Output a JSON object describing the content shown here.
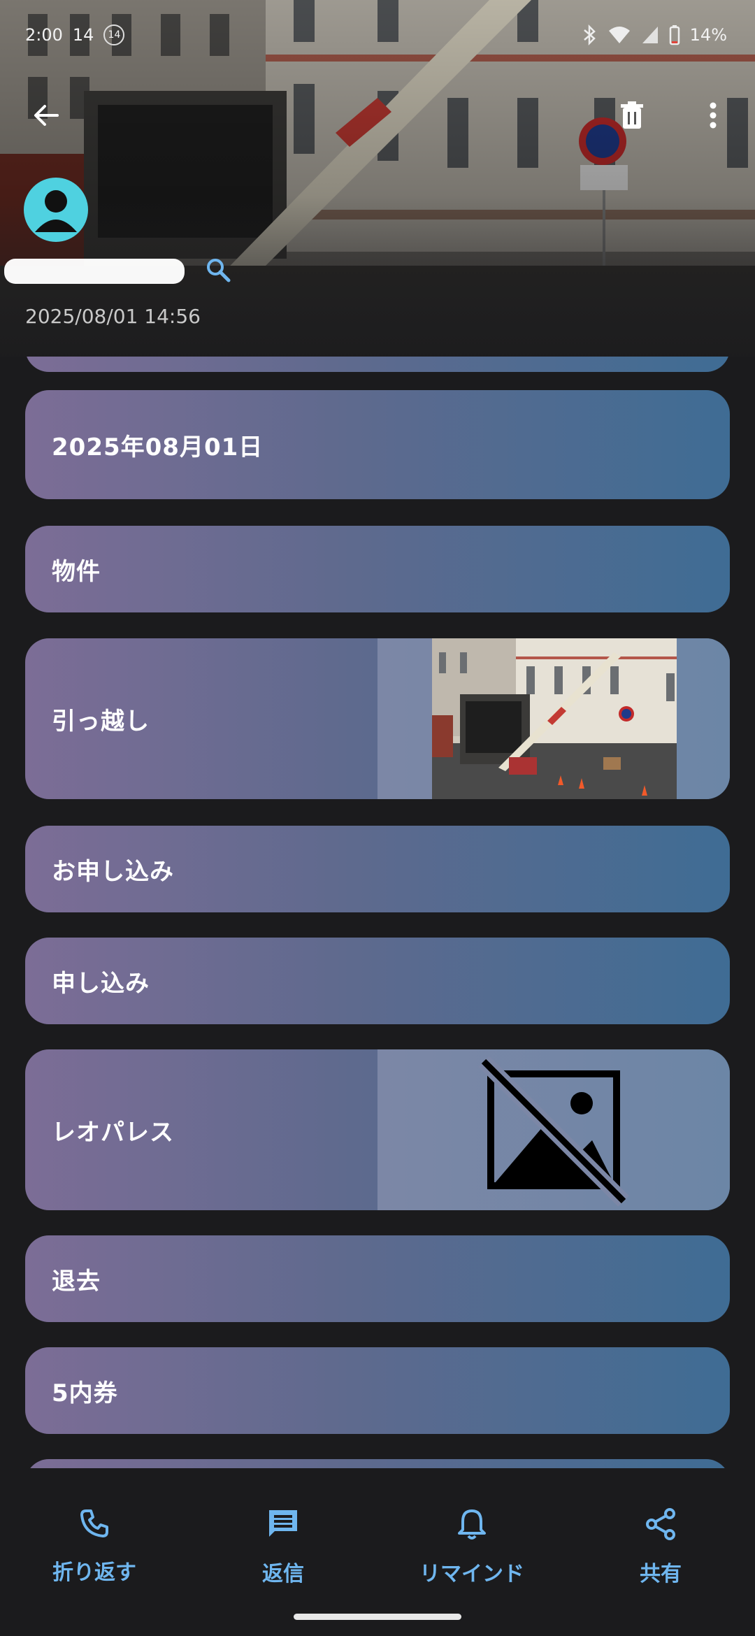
{
  "status_bar": {
    "time": "2:00",
    "notification_count": "14",
    "badge": "14",
    "battery": "14%"
  },
  "message": {
    "datetime": "2025/08/01 14:56",
    "sender_redacted": true
  },
  "cards": [
    {
      "label": "",
      "has_thumbnail": false
    },
    {
      "label": "2025年08月01日",
      "has_thumbnail": false
    },
    {
      "label": "物件",
      "has_thumbnail": false
    },
    {
      "label": "引っ越し",
      "has_thumbnail": true,
      "thumbnail": "moving-truck-photo"
    },
    {
      "label": "お申し込み",
      "has_thumbnail": false
    },
    {
      "label": "申し込み",
      "has_thumbnail": false
    },
    {
      "label": "レオパレス",
      "has_thumbnail": true,
      "thumbnail": "image-unavailable-icon"
    },
    {
      "label": "退去",
      "has_thumbnail": false
    },
    {
      "label": "5内券",
      "has_thumbnail": false
    },
    {
      "label": "",
      "has_thumbnail": false
    }
  ],
  "bottom_nav": {
    "call_back": "折り返す",
    "reply": "返信",
    "remind": "リマインド",
    "share": "共有"
  },
  "colors": {
    "accent": "#6fb6ef",
    "avatar": "#4fd1e0",
    "card_start": "#7c6d96",
    "card_end": "#3f6c94",
    "background": "#1b1b1d"
  }
}
